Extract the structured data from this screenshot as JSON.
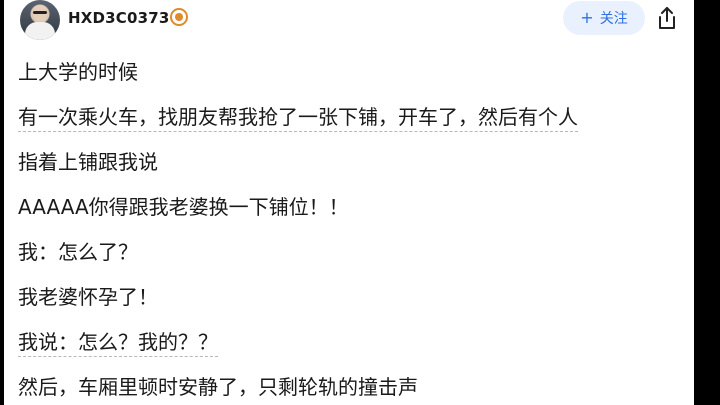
{
  "header": {
    "username": "HXD3C0373",
    "follow_label": "关注",
    "follow_icon": "plus-icon",
    "badge_icon": "level-badge-icon",
    "share_icon": "share-icon",
    "accent_color": "#2f6fe4"
  },
  "post": {
    "lines": [
      "上大学的时候",
      "有一次乘火车，找朋友帮我抢了一张下铺，开车了，然后有个人",
      "指着上铺跟我说",
      "AAAAA你得跟我老婆换一下铺位！！",
      "我：怎么了？",
      "我老婆怀孕了！",
      "我说：怎么？我的？？",
      "然后，车厢里顿时安静了，只剩轮轨的撞击声"
    ]
  }
}
